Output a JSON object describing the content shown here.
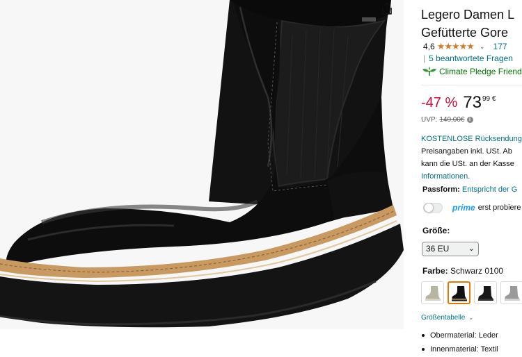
{
  "product": {
    "title_line1": "Legero Damen L",
    "title_line2": "Gefütterte Gore"
  },
  "rating": {
    "value": "4,6",
    "stars_icon": "★★★★★",
    "count": "177",
    "qa_link": "5 beantwortete Fragen",
    "climate_label": "Climate Pledge Friend"
  },
  "price": {
    "discount": "-47 %",
    "whole": "73",
    "fraction": "99 €",
    "uvp_label": "UVP:",
    "uvp_value": "140,00€"
  },
  "returns": {
    "link": "KOSTENLOSE Rücksendung",
    "line2": "Preisangaben inkl. USt. Ab",
    "line3": "kann die USt. an der Kasse",
    "line4": "Informationen."
  },
  "fit": {
    "label": "Passform:",
    "value": "Entspricht der G"
  },
  "prime": {
    "word": "prime",
    "text": "erst probiere"
  },
  "size": {
    "label": "Größe:",
    "selected": "36 EU"
  },
  "color": {
    "label": "Farbe:",
    "value": "Schwarz 0100"
  },
  "size_chart": "Größentabelle",
  "bullets": [
    "Obermaterial: Leder",
    "Innenmaterial: Textil"
  ],
  "colors": {
    "link": "#007185",
    "discount": "#cc0c39",
    "stars": "#de7921",
    "climate": "#007600",
    "prime": "#1399ff",
    "swatch_selected": "#e77600"
  }
}
